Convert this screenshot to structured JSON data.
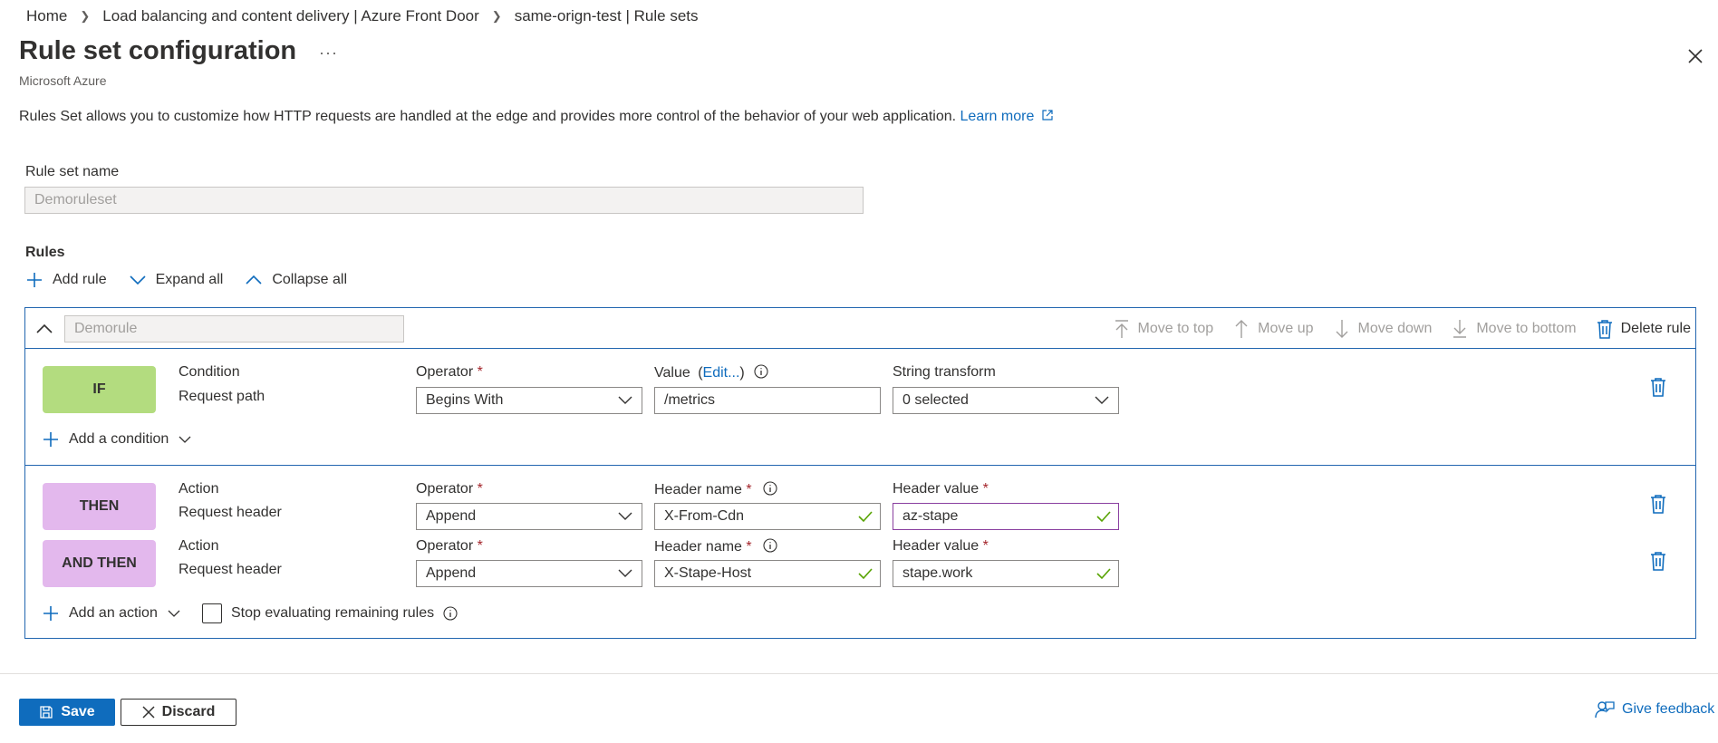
{
  "breadcrumb": [
    "Home",
    "Load balancing and content delivery | Azure Front Door",
    "same-orign-test | Rule sets"
  ],
  "page": {
    "title": "Rule set configuration",
    "more_label": "···",
    "subtitle": "Microsoft Azure",
    "description": "Rules Set allows you to customize how HTTP requests are handled at the edge and provides more control of the behavior of your web application.",
    "learn_more": "Learn more"
  },
  "ruleset": {
    "name_label": "Rule set name",
    "name_value": "Demoruleset"
  },
  "rules": {
    "heading": "Rules",
    "toolbar": {
      "add_rule": "Add rule",
      "expand_all": "Expand all",
      "collapse_all": "Collapse all"
    },
    "rule": {
      "name_value": "Demorule",
      "actions": {
        "move_top": "Move to top",
        "move_up": "Move up",
        "move_down": "Move down",
        "move_bottom": "Move to bottom",
        "delete": "Delete rule"
      },
      "condition": {
        "badge": "IF",
        "type_label": "Condition",
        "type_value": "Request path",
        "operator_label": "Operator",
        "operator_value": "Begins With",
        "value_label": "Value",
        "value_edit": "Edit...",
        "value_value": "/metrics",
        "transform_label": "String transform",
        "transform_value": "0 selected",
        "add_condition": "Add a condition"
      },
      "actions_list": [
        {
          "badge": "THEN",
          "type_label": "Action",
          "type_value": "Request header",
          "operator_label": "Operator",
          "operator_value": "Append",
          "header_name_label": "Header name",
          "header_name_value": "X-From-Cdn",
          "header_value_label": "Header value",
          "header_value_value": "az-stape"
        },
        {
          "badge": "AND THEN",
          "type_label": "Action",
          "type_value": "Request header",
          "operator_label": "Operator",
          "operator_value": "Append",
          "header_name_label": "Header name",
          "header_name_value": "X-Stape-Host",
          "header_value_label": "Header value",
          "header_value_value": "stape.work"
        }
      ],
      "add_action": "Add an action",
      "stop_evaluating": "Stop evaluating remaining rules"
    }
  },
  "footer": {
    "save": "Save",
    "discard": "Discard",
    "feedback": "Give feedback"
  },
  "colors": {
    "accent": "#0f6cbd",
    "if_badge": "#b3dc7f",
    "then_badge": "#e3b8ed",
    "border_active": "#2266b0"
  }
}
